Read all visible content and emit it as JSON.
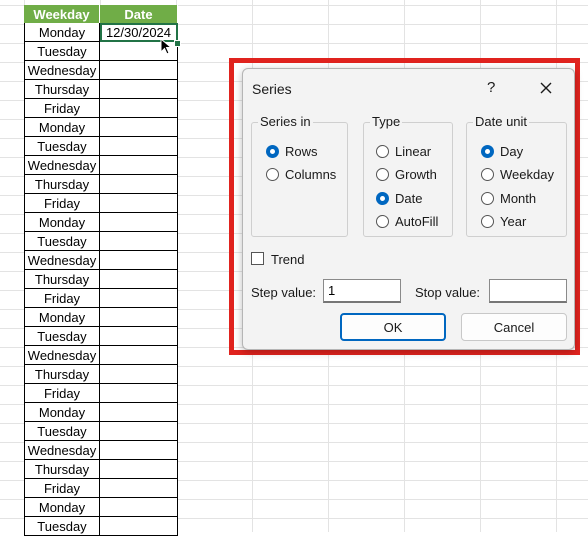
{
  "sheet": {
    "headers": [
      "Weekday",
      "Date"
    ],
    "rows": [
      {
        "weekday": "Monday",
        "date": "12/30/2024"
      },
      {
        "weekday": "Tuesday",
        "date": ""
      },
      {
        "weekday": "Wednesday",
        "date": ""
      },
      {
        "weekday": "Thursday",
        "date": ""
      },
      {
        "weekday": "Friday",
        "date": ""
      },
      {
        "weekday": "Monday",
        "date": ""
      },
      {
        "weekday": "Tuesday",
        "date": ""
      },
      {
        "weekday": "Wednesday",
        "date": ""
      },
      {
        "weekday": "Thursday",
        "date": ""
      },
      {
        "weekday": "Friday",
        "date": ""
      },
      {
        "weekday": "Monday",
        "date": ""
      },
      {
        "weekday": "Tuesday",
        "date": ""
      },
      {
        "weekday": "Wednesday",
        "date": ""
      },
      {
        "weekday": "Thursday",
        "date": ""
      },
      {
        "weekday": "Friday",
        "date": ""
      },
      {
        "weekday": "Monday",
        "date": ""
      },
      {
        "weekday": "Tuesday",
        "date": ""
      },
      {
        "weekday": "Wednesday",
        "date": ""
      },
      {
        "weekday": "Thursday",
        "date": ""
      },
      {
        "weekday": "Friday",
        "date": ""
      },
      {
        "weekday": "Monday",
        "date": ""
      },
      {
        "weekday": "Tuesday",
        "date": ""
      },
      {
        "weekday": "Wednesday",
        "date": ""
      },
      {
        "weekday": "Thursday",
        "date": ""
      },
      {
        "weekday": "Friday",
        "date": ""
      },
      {
        "weekday": "Monday",
        "date": ""
      },
      {
        "weekday": "Tuesday",
        "date": ""
      }
    ],
    "header_color": "#70ad47",
    "selection_color": "#217346"
  },
  "dialog": {
    "title": "Series",
    "help": "?",
    "series_in": {
      "label": "Series in",
      "options": [
        {
          "label": "Rows",
          "selected": true
        },
        {
          "label": "Columns",
          "selected": false
        }
      ]
    },
    "type": {
      "label": "Type",
      "options": [
        {
          "label": "Linear",
          "selected": false
        },
        {
          "label": "Growth",
          "selected": false
        },
        {
          "label": "Date",
          "selected": true
        },
        {
          "label": "AutoFill",
          "selected": false
        }
      ]
    },
    "date_unit": {
      "label": "Date unit",
      "options": [
        {
          "label": "Day",
          "selected": true
        },
        {
          "label": "Weekday",
          "selected": false
        },
        {
          "label": "Month",
          "selected": false
        },
        {
          "label": "Year",
          "selected": false
        }
      ]
    },
    "trend": {
      "label": "Trend",
      "checked": false
    },
    "step_value": {
      "label": "Step value:",
      "value": "1"
    },
    "stop_value": {
      "label": "Stop value:",
      "value": ""
    },
    "ok_label": "OK",
    "cancel_label": "Cancel",
    "accent_color": "#0067c0",
    "highlight_color": "#e0231e"
  }
}
